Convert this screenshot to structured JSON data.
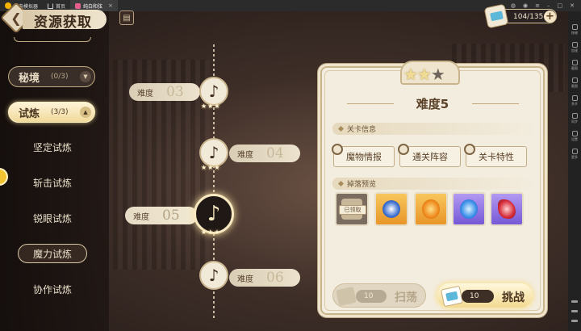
{
  "emulator": {
    "app_name": "雷电模拟器",
    "tab_home": "首页",
    "tab_game": "纯白和弦"
  },
  "sidebar": {
    "items": [
      "按键",
      "加速",
      "截图",
      "截图",
      "多开",
      "同步",
      "设置",
      "更多"
    ]
  },
  "header": {
    "title": "资源获取"
  },
  "stamina": {
    "value": "104/135",
    "plus": "+"
  },
  "menu": {
    "category_mijing": {
      "label": "秘境",
      "count": "(0/3)",
      "arrow": "▼"
    },
    "category_shilian": {
      "label": "试炼",
      "count": "(3/3)",
      "arrow": "▲"
    },
    "sub_items": [
      "坚定试炼",
      "斩击试炼",
      "锐眼试炼",
      "魔力试炼",
      "协作试炼"
    ]
  },
  "levels": [
    {
      "label": "难度",
      "number": "03",
      "stars": "★★★",
      "note": "♪"
    },
    {
      "label": "难度",
      "number": "04",
      "stars": "★★★",
      "note": "♪"
    },
    {
      "label": "难度",
      "number": "05",
      "stars": "★★★",
      "note": "♪"
    },
    {
      "label": "难度",
      "number": "06",
      "note": "♪"
    }
  ],
  "card": {
    "stars_on": "★★",
    "stars_off": "★",
    "title": "难度5",
    "section_info": "关卡信息",
    "btn_monsters": "魔物情报",
    "btn_lineup": "通关阵容",
    "btn_traits": "关卡特性",
    "section_drops": "掉落预览",
    "claimed_label": "已领取",
    "sweep_cost": "10",
    "sweep_label": "扫荡",
    "challenge_cost": "10",
    "challenge_label": "挑战"
  },
  "colors": {
    "accent_gold": "#f1dc95",
    "card_bg": "#f3eddf",
    "blue_item": "#6f95f0"
  }
}
